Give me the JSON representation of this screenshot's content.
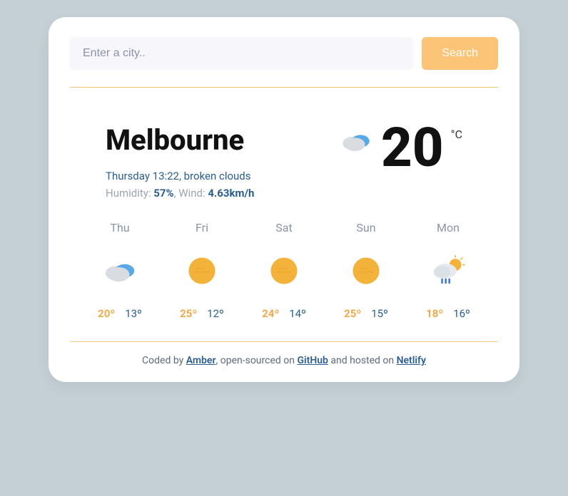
{
  "search": {
    "placeholder": "Enter a city..",
    "button": "Search"
  },
  "current": {
    "city": "Melbourne",
    "desc_line": "Thursday 13:22, broken clouds",
    "humidity_label": "Humidity: ",
    "humidity_value": "57%",
    "humidity_sep": ", ",
    "wind_label": "Wind: ",
    "wind_value": "4.63km/h",
    "temp": "20",
    "unit": "°C",
    "icon": "broken-clouds"
  },
  "forecast": [
    {
      "day": "Thu",
      "icon": "broken-clouds",
      "hi": "20º",
      "lo": "13º"
    },
    {
      "day": "Fri",
      "icon": "sunny",
      "hi": "25º",
      "lo": "12º"
    },
    {
      "day": "Sat",
      "icon": "sunny",
      "hi": "24º",
      "lo": "14º"
    },
    {
      "day": "Sun",
      "icon": "sunny",
      "hi": "25º",
      "lo": "15º"
    },
    {
      "day": "Mon",
      "icon": "rain-sun",
      "hi": "18º",
      "lo": "16º"
    }
  ],
  "footer": {
    "t1": "Coded by ",
    "link1": "Amber",
    "t2": ", open-sourced on ",
    "link2": "GitHub",
    "t3": " and hosted on ",
    "link3": "Netlify"
  }
}
